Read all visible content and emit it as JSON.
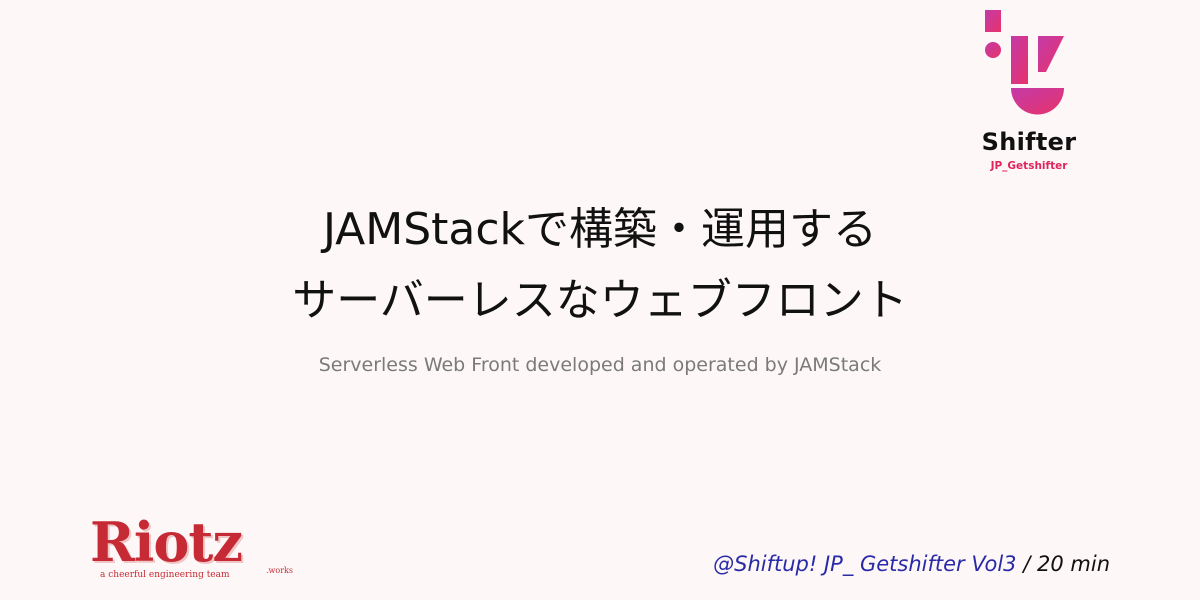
{
  "shifter": {
    "name": "Shifter",
    "handle": "JP_Getshifter",
    "icon": "shifter-logo-mark",
    "colors": {
      "gradient_start": "#c33ba8",
      "gradient_end": "#e8326a"
    }
  },
  "title": {
    "line1": "JAMStackで構築・運用する",
    "line2": "サーバーレスなウェブフロント"
  },
  "subtitle": "Serverless Web Front developed and operated by JAMStack",
  "riotz": {
    "wordmark": "Riotz",
    "tagline": "a cheerful engineering team",
    "suffix": ".works",
    "color": "#c62a34"
  },
  "event": {
    "name": "@Shiftup! JP_ Getshifter Vol3",
    "separator": "/",
    "duration": "20 min",
    "name_color": "#2a2aa8"
  }
}
